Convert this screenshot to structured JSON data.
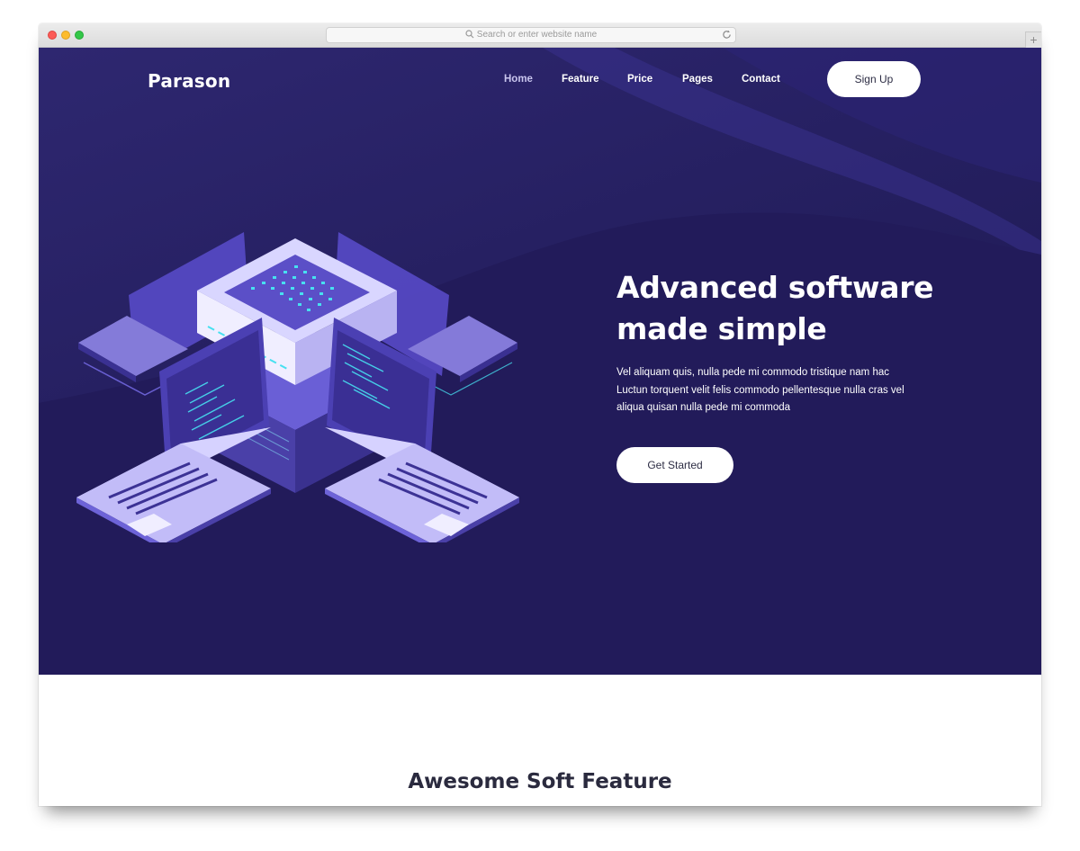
{
  "browser": {
    "address_placeholder": "Search or enter website name",
    "new_tab_symbol": "+"
  },
  "header": {
    "logo": "Parason",
    "nav": [
      "Home",
      "Feature",
      "Price",
      "Pages",
      "Contact"
    ],
    "active_nav": "Home",
    "signup_label": "Sign Up"
  },
  "hero": {
    "headline_line1": "Advanced software",
    "headline_line2": "made simple",
    "description_line1": "Vel aliquam quis, nulla pede mi commodo tristique nam hac",
    "description_line2": "Luctun torquent velit felis commodo pellentesque nulla cras vel",
    "description_line3": "aliqua quisan nulla pede mi commoda",
    "cta_label": "Get Started",
    "illustration": "isometric-server-laptops-illustration"
  },
  "features": {
    "title": "Awesome Soft Feature"
  },
  "colors": {
    "hero_bg": "#261e60",
    "accent_purple": "#5b4fc7",
    "accent_cyan": "#47e0f0",
    "button_bg": "#ffffff",
    "heading_dark": "#2a2a3e"
  }
}
